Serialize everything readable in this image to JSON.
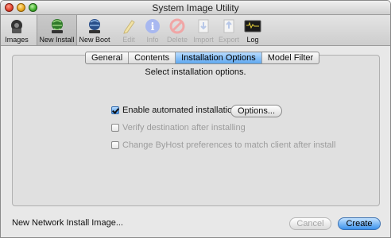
{
  "window": {
    "title": "System Image Utility"
  },
  "toolbar": {
    "items": [
      {
        "label": "Images",
        "icon": "images-icon",
        "enabled": true
      },
      {
        "label": "New Install",
        "icon": "new-install-icon",
        "enabled": true,
        "selected": true
      },
      {
        "label": "New Boot",
        "icon": "new-boot-icon",
        "enabled": true
      },
      {
        "label": "Edit",
        "icon": "edit-icon",
        "enabled": false
      },
      {
        "label": "Info",
        "icon": "info-icon",
        "enabled": false
      },
      {
        "label": "Delete",
        "icon": "delete-icon",
        "enabled": false
      },
      {
        "label": "Import",
        "icon": "import-icon",
        "enabled": false
      },
      {
        "label": "Export",
        "icon": "export-icon",
        "enabled": false
      },
      {
        "label": "Log",
        "icon": "log-icon",
        "enabled": true
      }
    ]
  },
  "tabs": [
    "General",
    "Contents",
    "Installation Options",
    "Model Filter"
  ],
  "active_tab": "Installation Options",
  "main": {
    "instruction": "Select installation options.",
    "options": [
      {
        "label": "Enable automated installation",
        "checked": true,
        "enabled": true
      },
      {
        "label": "Verify destination after installing",
        "checked": false,
        "enabled": false
      },
      {
        "label": "Change ByHost preferences to match client after install",
        "checked": false,
        "enabled": false
      }
    ],
    "options_button": "Options..."
  },
  "footer": {
    "image_name": "New Network Install Image...",
    "cancel": "Cancel",
    "create": "Create"
  },
  "colors": {
    "accent": "#3b92ec",
    "tab_active": "#5fa8f0"
  }
}
